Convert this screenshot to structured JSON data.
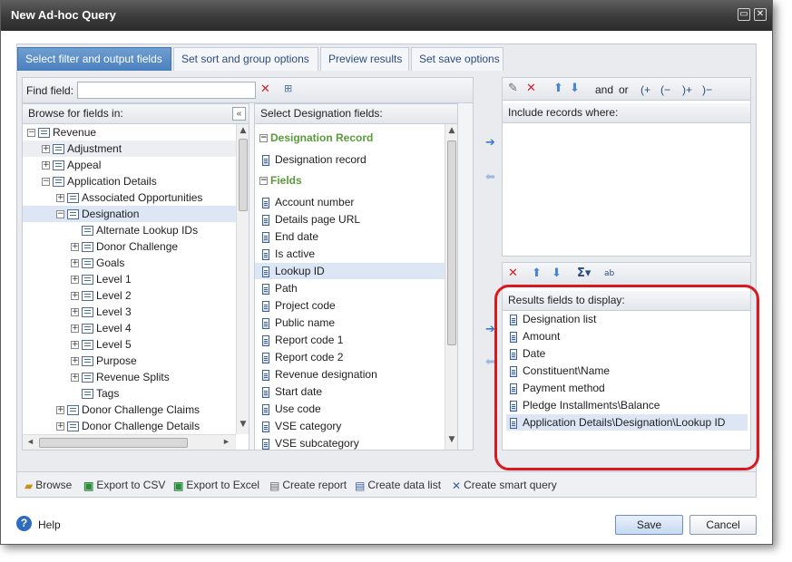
{
  "window": {
    "title": "New Ad-hoc Query"
  },
  "tabs": [
    {
      "label": "Select filter and output fields",
      "active": true
    },
    {
      "label": "Set sort and group options"
    },
    {
      "label": "Preview results"
    },
    {
      "label": "Set save options"
    }
  ],
  "find": {
    "label": "Find field:",
    "value": ""
  },
  "browse": {
    "header": "Browse for fields in:",
    "tree": [
      {
        "label": "Revenue",
        "level": 0,
        "expander": "−"
      },
      {
        "label": "Adjustment",
        "level": 1,
        "expander": "+"
      },
      {
        "label": "Appeal",
        "level": 1,
        "expander": "+"
      },
      {
        "label": "Application Details",
        "level": 1,
        "expander": "−"
      },
      {
        "label": "Associated Opportunities",
        "level": 2,
        "expander": "+"
      },
      {
        "label": "Designation",
        "level": 2,
        "expander": "−",
        "selected": true
      },
      {
        "label": "Alternate Lookup IDs",
        "level": 3,
        "expander": ""
      },
      {
        "label": "Donor Challenge",
        "level": 3,
        "expander": "+"
      },
      {
        "label": "Goals",
        "level": 3,
        "expander": "+"
      },
      {
        "label": "Level 1",
        "level": 3,
        "expander": "+"
      },
      {
        "label": "Level 2",
        "level": 3,
        "expander": "+"
      },
      {
        "label": "Level 3",
        "level": 3,
        "expander": "+"
      },
      {
        "label": "Level 4",
        "level": 3,
        "expander": "+"
      },
      {
        "label": "Level 5",
        "level": 3,
        "expander": "+"
      },
      {
        "label": "Purpose",
        "level": 3,
        "expander": "+"
      },
      {
        "label": "Revenue Splits",
        "level": 3,
        "expander": "+"
      },
      {
        "label": "Tags",
        "level": 3,
        "expander": ""
      },
      {
        "label": "Donor Challenge Claims",
        "level": 2,
        "expander": "+"
      },
      {
        "label": "Donor Challenge Details",
        "level": 2,
        "expander": "+"
      }
    ]
  },
  "designation": {
    "header": "Select Designation fields:",
    "record_section": "Designation Record",
    "record_fields": [
      "Designation record"
    ],
    "fields_section": "Fields",
    "fields": [
      "Account number",
      "Details page URL",
      "End date",
      "Is active",
      "Lookup ID",
      "Path",
      "Project code",
      "Public name",
      "Report code 1",
      "Report code 2",
      "Revenue designation",
      "Start date",
      "Use code",
      "VSE category",
      "VSE subcategory"
    ],
    "selected": "Lookup ID"
  },
  "filter": {
    "header": "Include records where:",
    "and_label": "and",
    "or_label": "or",
    "paren_buttons": [
      "(+",
      "(−",
      ")+",
      ")−"
    ]
  },
  "results": {
    "header": "Results fields to display:",
    "fields": [
      "Designation list",
      "Amount",
      "Date",
      "Constituent\\Name",
      "Payment method",
      "Pledge Installments\\Balance",
      "Application Details\\Designation\\Lookup ID"
    ],
    "selected_index": 6
  },
  "actions": [
    "Browse",
    "Export to CSV",
    "Export to Excel",
    "Create report",
    "Create data list",
    "Create smart query"
  ],
  "footer": {
    "help_label": "Help",
    "save_label": "Save",
    "cancel_label": "Cancel"
  },
  "colors": {
    "highlight_ring": "#d9191f",
    "tab_active": "#4a7fbf",
    "section_green": "#5a9a3c",
    "selection": "#dce6f4"
  }
}
